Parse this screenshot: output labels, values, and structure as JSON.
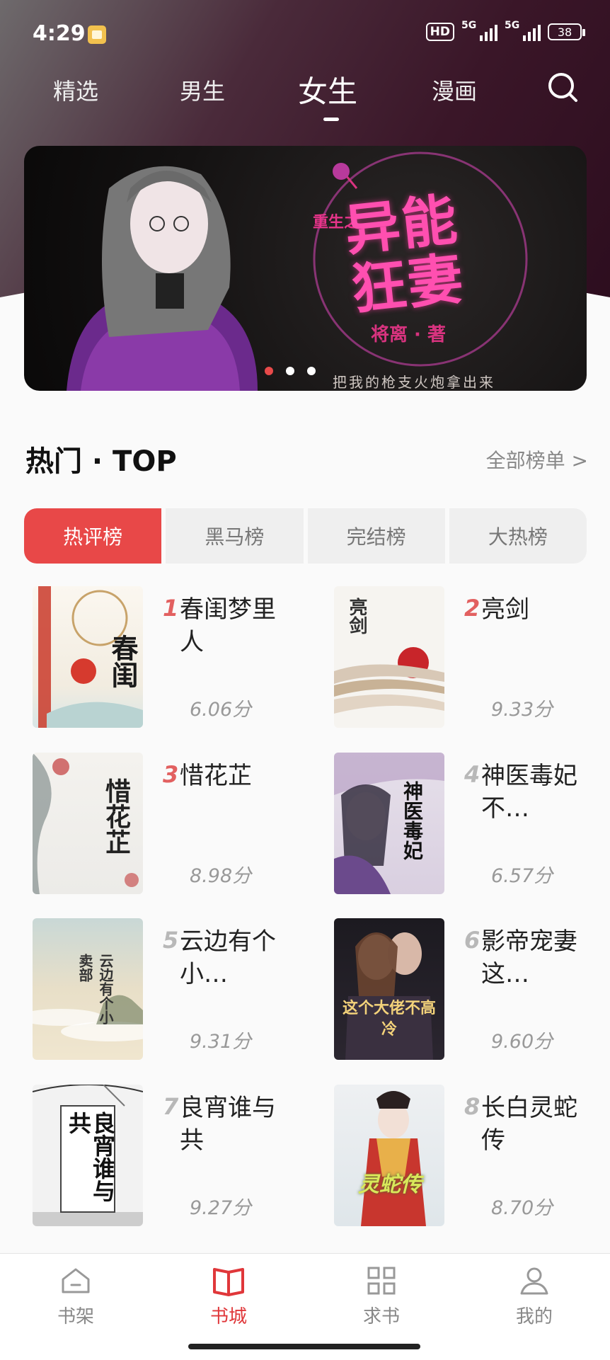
{
  "status_bar": {
    "time": "4:29",
    "hd": "HD",
    "net1": "5G",
    "net2": "5G",
    "battery": "38"
  },
  "top_nav": {
    "tabs": [
      {
        "label": "精选"
      },
      {
        "label": "男生"
      },
      {
        "label": "女生",
        "active": true
      },
      {
        "label": "漫画"
      }
    ]
  },
  "banner": {
    "title_small": "重生之",
    "title": "异能狂妻",
    "author": "将离 · 著",
    "slogan": "把我的枪支火炮拿出来",
    "page_count": 3,
    "active_page": 1
  },
  "section": {
    "title": "热门 · TOP",
    "link": "全部榜单 >"
  },
  "rank_tabs": [
    {
      "label": "热评榜",
      "active": true
    },
    {
      "label": "黑马榜"
    },
    {
      "label": "完结榜"
    },
    {
      "label": "大热榜"
    }
  ],
  "books": [
    {
      "rank": "1",
      "title": "春闺梦里人",
      "score": "6.06分",
      "cover_text": "春闺"
    },
    {
      "rank": "2",
      "title": "亮剑",
      "score": "9.33分",
      "cover_text": "亮剑"
    },
    {
      "rank": "3",
      "title": "惜花芷",
      "score": "8.98分",
      "cover_text": "惜花芷"
    },
    {
      "rank": "4",
      "title": "神医毒妃不…",
      "score": "6.57分",
      "cover_text": "神医毒妃"
    },
    {
      "rank": "5",
      "title": "云边有个小…",
      "score": "9.31分",
      "cover_text": "云边有个小卖部"
    },
    {
      "rank": "6",
      "title": "影帝宠妻这…",
      "score": "9.60分",
      "cover_text": "这个大佬不高冷"
    },
    {
      "rank": "7",
      "title": "良宵谁与共",
      "score": "9.27分",
      "cover_text": "良宵谁与共"
    },
    {
      "rank": "8",
      "title": "长白灵蛇传",
      "score": "8.70分",
      "cover_text": "灵蛇传"
    }
  ],
  "bottom_nav": [
    {
      "label": "书架",
      "icon": "bookshelf-icon"
    },
    {
      "label": "书城",
      "icon": "open-book-icon",
      "active": true
    },
    {
      "label": "求书",
      "icon": "grid-icon"
    },
    {
      "label": "我的",
      "icon": "person-icon"
    }
  ],
  "colors": {
    "accent": "#e84848",
    "rank_red": "#e26060",
    "rank_gray": "#b8b8b8"
  }
}
